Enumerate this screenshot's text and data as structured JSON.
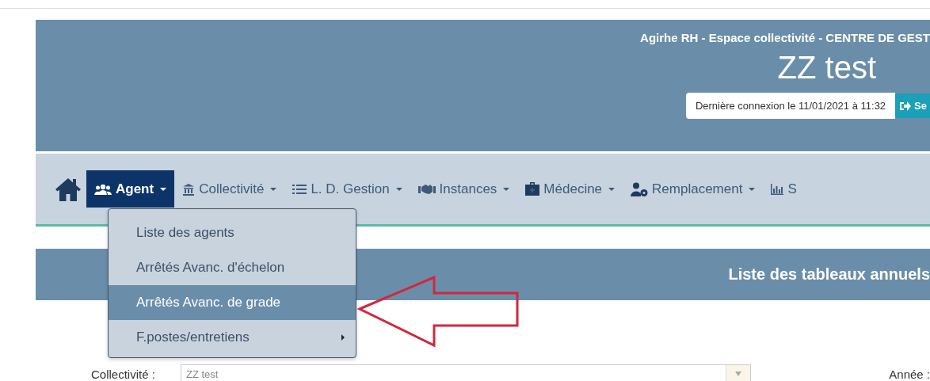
{
  "header": {
    "title": "Agirhe RH - Espace collectivité - CENTRE DE GEST",
    "name": "ZZ test",
    "last_login": "Dernière connexion le 11/01/2021 à 11:32",
    "logout_button": "Se"
  },
  "nav": {
    "items": [
      {
        "label": "Agent",
        "selected": true
      },
      {
        "label": "Collectivité",
        "selected": false
      },
      {
        "label": "L. D. Gestion",
        "selected": false
      },
      {
        "label": "Instances",
        "selected": false
      },
      {
        "label": "Médecine",
        "selected": false
      },
      {
        "label": "Remplacement",
        "selected": false
      },
      {
        "label": "S",
        "selected": false
      }
    ]
  },
  "menu": {
    "items": [
      {
        "label": "Liste des agents",
        "selected": false,
        "submenu": false
      },
      {
        "label": "Arrêtés Avanc. d'échelon",
        "selected": false,
        "submenu": false
      },
      {
        "label": "Arrêtés Avanc. de grade",
        "selected": true,
        "submenu": false
      },
      {
        "label": "F.postes/entretiens",
        "selected": false,
        "submenu": true
      }
    ]
  },
  "page_title": "Liste des tableaux annuels",
  "form": {
    "collectivite_label": "Collectivité :",
    "collectivite_value": "ZZ test",
    "annee_label": "Année :"
  }
}
